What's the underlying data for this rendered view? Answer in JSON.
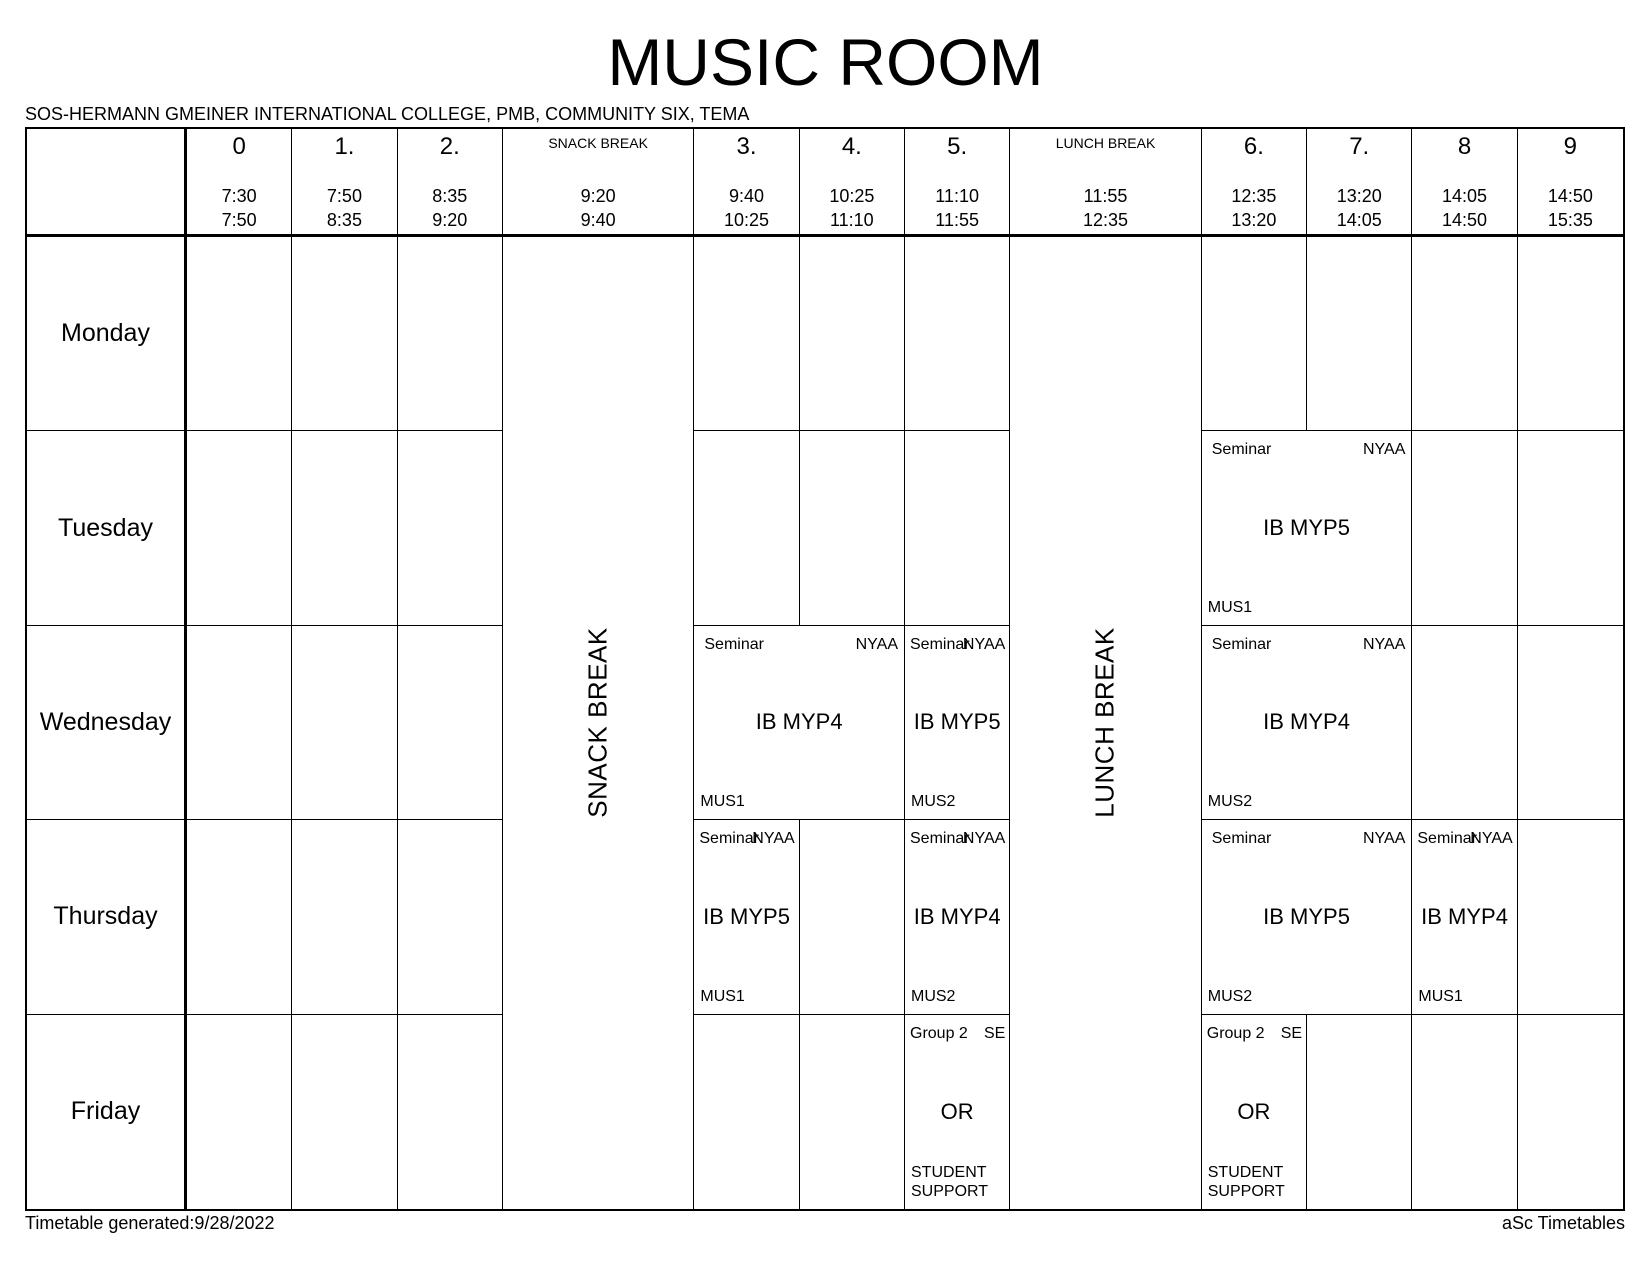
{
  "title": "MUSIC ROOM",
  "school": "SOS-HERMANN GMEINER INTERNATIONAL COLLEGE, PMB, COMMUNITY SIX, TEMA",
  "periods": [
    {
      "label": "0",
      "start": "7:30",
      "end": "7:50"
    },
    {
      "label": "1.",
      "start": "7:50",
      "end": "8:35"
    },
    {
      "label": "2.",
      "start": "8:35",
      "end": "9:20"
    },
    {
      "label": "SNACK BREAK",
      "start": "9:20",
      "end": "9:40",
      "small": true
    },
    {
      "label": "3.",
      "start": "9:40",
      "end": "10:25"
    },
    {
      "label": "4.",
      "start": "10:25",
      "end": "11:10"
    },
    {
      "label": "5.",
      "start": "11:10",
      "end": "11:55"
    },
    {
      "label": "LUNCH BREAK",
      "start": "11:55",
      "end": "12:35",
      "small": true
    },
    {
      "label": "6.",
      "start": "12:35",
      "end": "13:20"
    },
    {
      "label": "7.",
      "start": "13:20",
      "end": "14:05"
    },
    {
      "label": "8",
      "start": "14:05",
      "end": "14:50"
    },
    {
      "label": "9",
      "start": "14:50",
      "end": "15:35"
    }
  ],
  "breaks": {
    "snack": "SNACK BREAK",
    "lunch": "LUNCH BREAK"
  },
  "days": [
    {
      "name": "Monday",
      "cells": [
        {
          "col": 2
        },
        {
          "col": 3
        },
        {
          "col": 4
        },
        {
          "col": 6
        },
        {
          "col": 7
        },
        {
          "col": 8
        },
        {
          "col": 10
        },
        {
          "col": 11
        },
        {
          "col": 12
        },
        {
          "col": 13
        }
      ]
    },
    {
      "name": "Tuesday",
      "cells": [
        {
          "col": 2
        },
        {
          "col": 3
        },
        {
          "col": 4
        },
        {
          "col": 6
        },
        {
          "col": 7
        },
        {
          "col": 8
        },
        {
          "col": 10,
          "span": 2,
          "lesson": {
            "tl": "Seminar",
            "tr": "NYAA",
            "ct": "IB MYP5",
            "bl": "MUS1"
          }
        },
        {
          "col": 12
        },
        {
          "col": 13
        }
      ]
    },
    {
      "name": "Wednesday",
      "cells": [
        {
          "col": 2
        },
        {
          "col": 3
        },
        {
          "col": 4
        },
        {
          "col": 6,
          "span": 2,
          "lesson": {
            "tl": "Seminar",
            "tr": "NYAA",
            "ct": "IB MYP4",
            "bl": "MUS1"
          }
        },
        {
          "col": 8,
          "lesson": {
            "tl": "Seminar",
            "tr": "NYAA",
            "ct": "IB MYP5",
            "bl": "MUS2"
          }
        },
        {
          "col": 10,
          "span": 2,
          "lesson": {
            "tl": "Seminar",
            "tr": "NYAA",
            "ct": "IB MYP4",
            "bl": "MUS2"
          }
        },
        {
          "col": 12
        },
        {
          "col": 13
        }
      ]
    },
    {
      "name": "Thursday",
      "cells": [
        {
          "col": 2
        },
        {
          "col": 3
        },
        {
          "col": 4
        },
        {
          "col": 6,
          "lesson": {
            "tl": "Seminar",
            "tr": "NYAA",
            "ct": "IB MYP5",
            "bl": "MUS1"
          }
        },
        {
          "col": 7
        },
        {
          "col": 8,
          "lesson": {
            "tl": "Seminar",
            "tr": "NYAA",
            "ct": "IB MYP4",
            "bl": "MUS2"
          }
        },
        {
          "col": 10,
          "span": 2,
          "lesson": {
            "tl": "Seminar",
            "tr": "NYAA",
            "ct": "IB MYP5",
            "bl": "MUS2"
          }
        },
        {
          "col": 12,
          "lesson": {
            "tl": "Seminar",
            "tr": "NYAA",
            "ct": "IB MYP4",
            "bl": "MUS1"
          }
        },
        {
          "col": 13
        }
      ]
    },
    {
      "name": "Friday",
      "cells": [
        {
          "col": 2
        },
        {
          "col": 3
        },
        {
          "col": 4
        },
        {
          "col": 6
        },
        {
          "col": 7
        },
        {
          "col": 8,
          "lesson": {
            "tl": "Group 2",
            "tr": "SE",
            "ct": "OR",
            "bl": "STUDENT SUPPORT"
          }
        },
        {
          "col": 10,
          "lesson": {
            "tl": "Group 2",
            "tr": "SE",
            "ct": "OR",
            "bl": "STUDENT SUPPORT"
          }
        },
        {
          "col": 11
        },
        {
          "col": 12
        },
        {
          "col": 13
        }
      ]
    }
  ],
  "footer": {
    "generated": "Timetable generated:9/28/2022",
    "brand": "aSc Timetables"
  }
}
